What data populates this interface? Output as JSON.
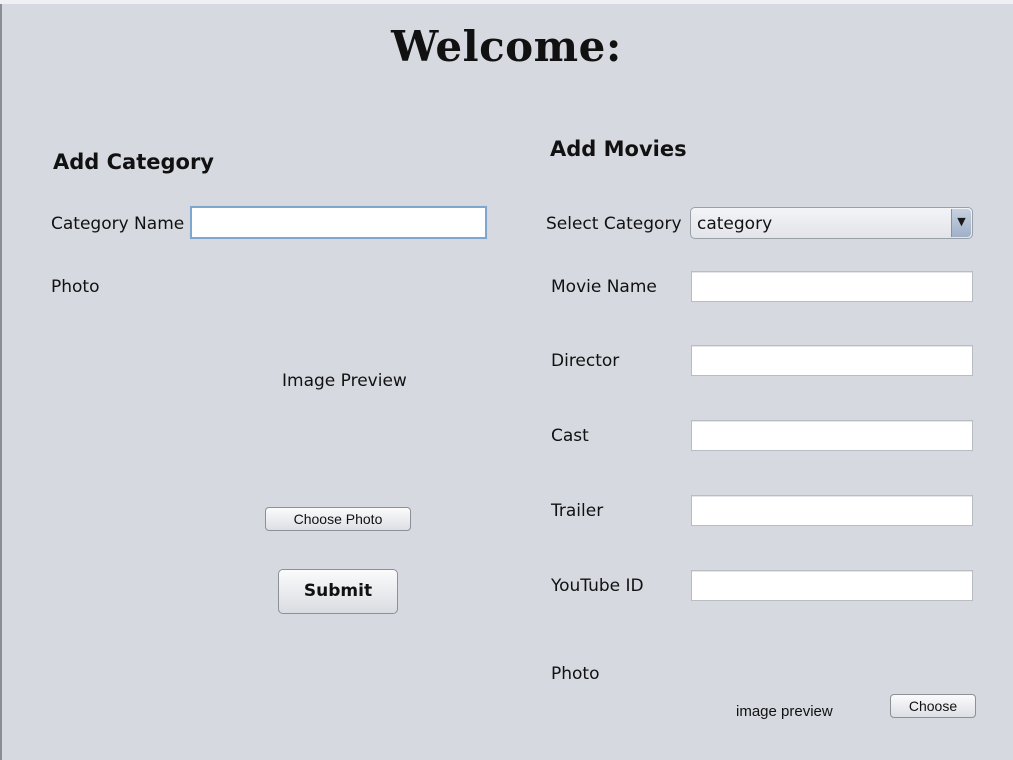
{
  "welcome": "Welcome:",
  "category_panel": {
    "heading": "Add Category",
    "name_label": "Category Name",
    "name_value": "",
    "photo_label": "Photo",
    "image_preview": "Image Preview",
    "choose_photo_button": "Choose Photo",
    "submit_button": "Submit"
  },
  "movies_panel": {
    "heading": "Add Movies",
    "select_category_label": "Select Category",
    "select_category_value": "category",
    "movie_name_label": "Movie Name",
    "director_label": "Director",
    "cast_label": "Cast",
    "trailer_label": "Trailer",
    "youtube_id_label": "YouTube ID",
    "photo_label": "Photo",
    "image_preview": "image preview",
    "choose_button": "Choose",
    "dropdown_arrow": "▼"
  }
}
